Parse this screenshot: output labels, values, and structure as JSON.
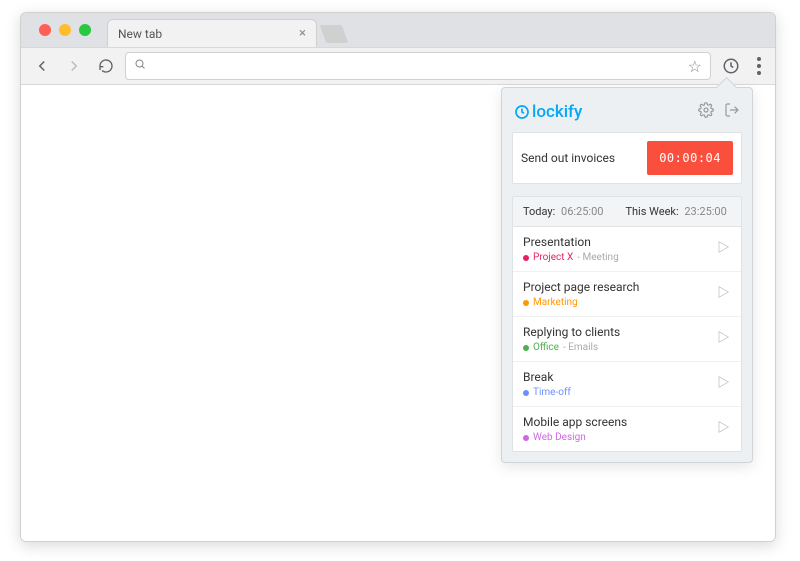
{
  "browser": {
    "tab_title": "New tab",
    "omnibox_value": ""
  },
  "popup": {
    "brand": "lockify",
    "timer": {
      "description": "Send out invoices",
      "elapsed": "00:00:04"
    },
    "stats": {
      "today_label": "Today:",
      "today_value": "06:25:00",
      "week_label": "This Week:",
      "week_value": "23:25:00"
    },
    "entries": [
      {
        "title": "Presentation",
        "project": "Project X",
        "project_color": "#e91e63",
        "task": "Meeting"
      },
      {
        "title": "Project page research",
        "project": "Marketing",
        "project_color": "#ff9800",
        "task": ""
      },
      {
        "title": "Replying to clients",
        "project": "Office",
        "project_color": "#4caf50",
        "task": "Emails"
      },
      {
        "title": "Break",
        "project": "Time-off",
        "project_color": "#6d8eff",
        "task": ""
      },
      {
        "title": "Mobile app screens",
        "project": "Web Design",
        "project_color": "#d066e6",
        "task": ""
      }
    ]
  }
}
